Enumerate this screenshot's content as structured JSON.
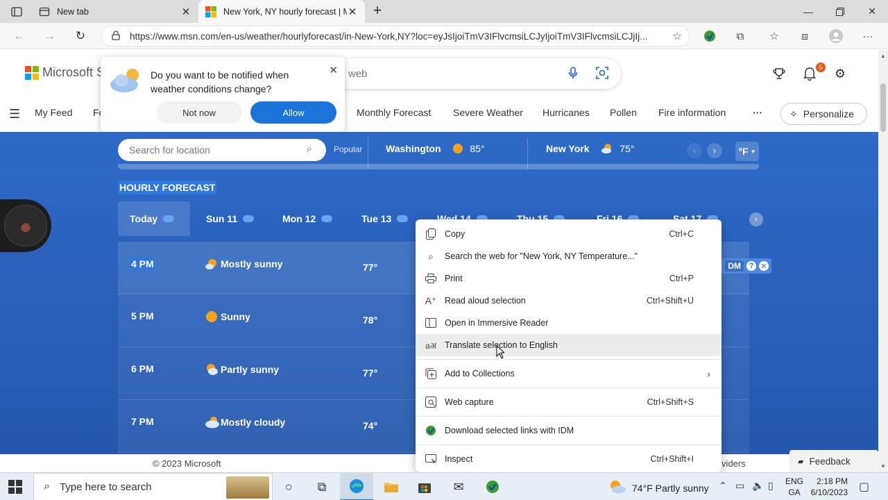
{
  "browser": {
    "tabs": [
      {
        "title": "New tab"
      },
      {
        "title": "New York, NY hourly forecast | M"
      }
    ],
    "url": "https://www.msn.com/en-us/weather/hourlyforecast/in-New-York,NY?loc=eyJsIjoiTmV3IFlvcmsiLCJyIjoiTmV3IFlvcmsiLCJjIj..."
  },
  "msn": {
    "brand": "Microsoft St",
    "search_placeholder": "web",
    "notification_count": "5",
    "nav": [
      "My Feed",
      "Fo",
      "Monthly Forecast",
      "Severe Weather",
      "Hurricanes",
      "Pollen",
      "Fire information"
    ],
    "more": "···",
    "personalize": "Personalize"
  },
  "notify_popup": {
    "message": "Do you want to be notified when weather conditions change?",
    "not_now": "Not now",
    "allow": "Allow"
  },
  "weather": {
    "location_search_placeholder": "Search for location",
    "popular_label": "Popular",
    "cities": [
      {
        "name": "Washington",
        "temp": "85°"
      },
      {
        "name": "New York",
        "temp": "75°"
      }
    ],
    "unit": "°F",
    "section_title": "HOURLY FORECAST",
    "days": [
      "Today",
      "Sun 11",
      "Mon 12",
      "Tue 13",
      "Wed 14",
      "Thu 15",
      "Fri 16",
      "Sat 17"
    ],
    "hours": [
      {
        "time": "4 PM",
        "condition": "Mostly sunny",
        "temp": "77°",
        "icon": "partly-sunny-icon"
      },
      {
        "time": "5 PM",
        "condition": "Sunny",
        "temp": "78°",
        "icon": "sunny-icon"
      },
      {
        "time": "6 PM",
        "condition": "Partly sunny",
        "temp": "77°",
        "icon": "partly-sunny-icon"
      },
      {
        "time": "7 PM",
        "condition": "Mostly cloudy",
        "temp": "74°",
        "icon": "cloudy-icon"
      }
    ],
    "idm_label": "DM"
  },
  "context_menu": {
    "items": [
      {
        "label": "Copy",
        "shortcut": "Ctrl+C",
        "icon": "copy-icon"
      },
      {
        "label": "Search the web for \"New York, NY   Temperature...\"",
        "shortcut": "",
        "icon": "search-icon"
      },
      {
        "label": "Print",
        "shortcut": "Ctrl+P",
        "icon": "print-icon"
      },
      {
        "label": "Read aloud selection",
        "shortcut": "Ctrl+Shift+U",
        "icon": "read-aloud-icon"
      },
      {
        "label": "Open in Immersive Reader",
        "shortcut": "",
        "icon": "immersive-reader-icon"
      },
      {
        "label": "Translate selection to English",
        "shortcut": "",
        "icon": "translate-icon"
      },
      {
        "label": "Add to Collections",
        "shortcut": "",
        "icon": "collections-icon"
      },
      {
        "label": "Web capture",
        "shortcut": "Ctrl+Shift+S",
        "icon": "web-capture-icon"
      },
      {
        "label": "Download selected links with IDM",
        "shortcut": "",
        "icon": "idm-icon"
      },
      {
        "label": "Inspect",
        "shortcut": "Ctrl+Shift+I",
        "icon": "inspect-icon"
      }
    ]
  },
  "footer": {
    "copyright": "© 2023 Microsoft",
    "providers": "viders",
    "feedback": "Feedback"
  },
  "taskbar": {
    "search_placeholder": "Type here to search",
    "weather": "74°F  Partly sunny",
    "lang_line1": "ENG",
    "lang_line2": "GA",
    "time": "2:18 PM",
    "date": "6/10/2023"
  },
  "colors": {
    "accent": "#1a73d9",
    "weather_bg": "#2a62bd",
    "notification_badge": "#e55a1b"
  }
}
